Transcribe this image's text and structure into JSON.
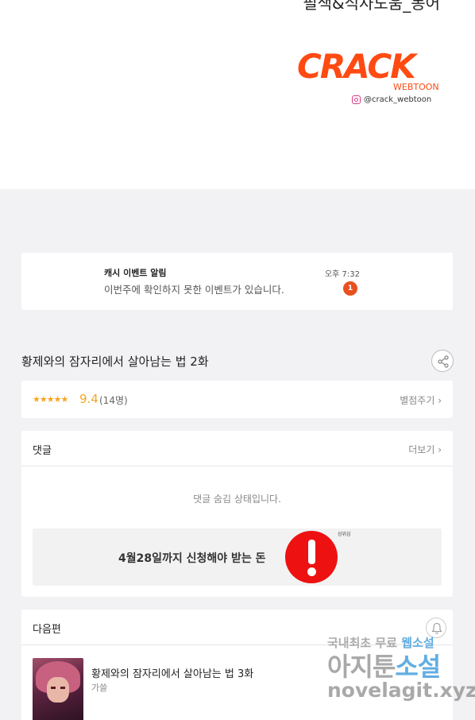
{
  "comic_panel": {
    "credit_line": "필색&식사도움_동어",
    "logo_text": "CRACK",
    "logo_subtext": "WEBTOON",
    "instagram_handle": "@crack_webtoon"
  },
  "notification": {
    "title": "캐시 이벤트 알림",
    "message": "이번주에 확인하지 못한 이벤트가 있습니다.",
    "time": "오후 7:32",
    "badge_count": "1"
  },
  "episode": {
    "title": "황제와의 잠자리에서 살아남는 법 2화"
  },
  "rating": {
    "stars": "★★★★★",
    "score": "9.4",
    "count": "(14명)",
    "rate_button": "별점주기 ›"
  },
  "comments": {
    "header": "댓글",
    "more_button": "더보기 ›",
    "hidden_message": "댓글 숨김 상태입니다.",
    "ad_text": "4월28일까지 신청해야 받는 돈",
    "ad_mini_label": "상위심"
  },
  "next_episode": {
    "header": "다음편",
    "title": "황제와의 잠자리에서 살아남는 법 3화",
    "author": "가쓸"
  },
  "watermark": {
    "line1_a": "국내최초 무료 ",
    "line1_b": "웹소설",
    "line2_a": "아지툰",
    "line2_b": "소설",
    "line3": "novelagit.xyz"
  },
  "colors": {
    "accent_orange": "#f5a623",
    "badge_red": "#e8501f",
    "logo_orange": "#ff4a12",
    "alert_red": "#ee1111"
  }
}
